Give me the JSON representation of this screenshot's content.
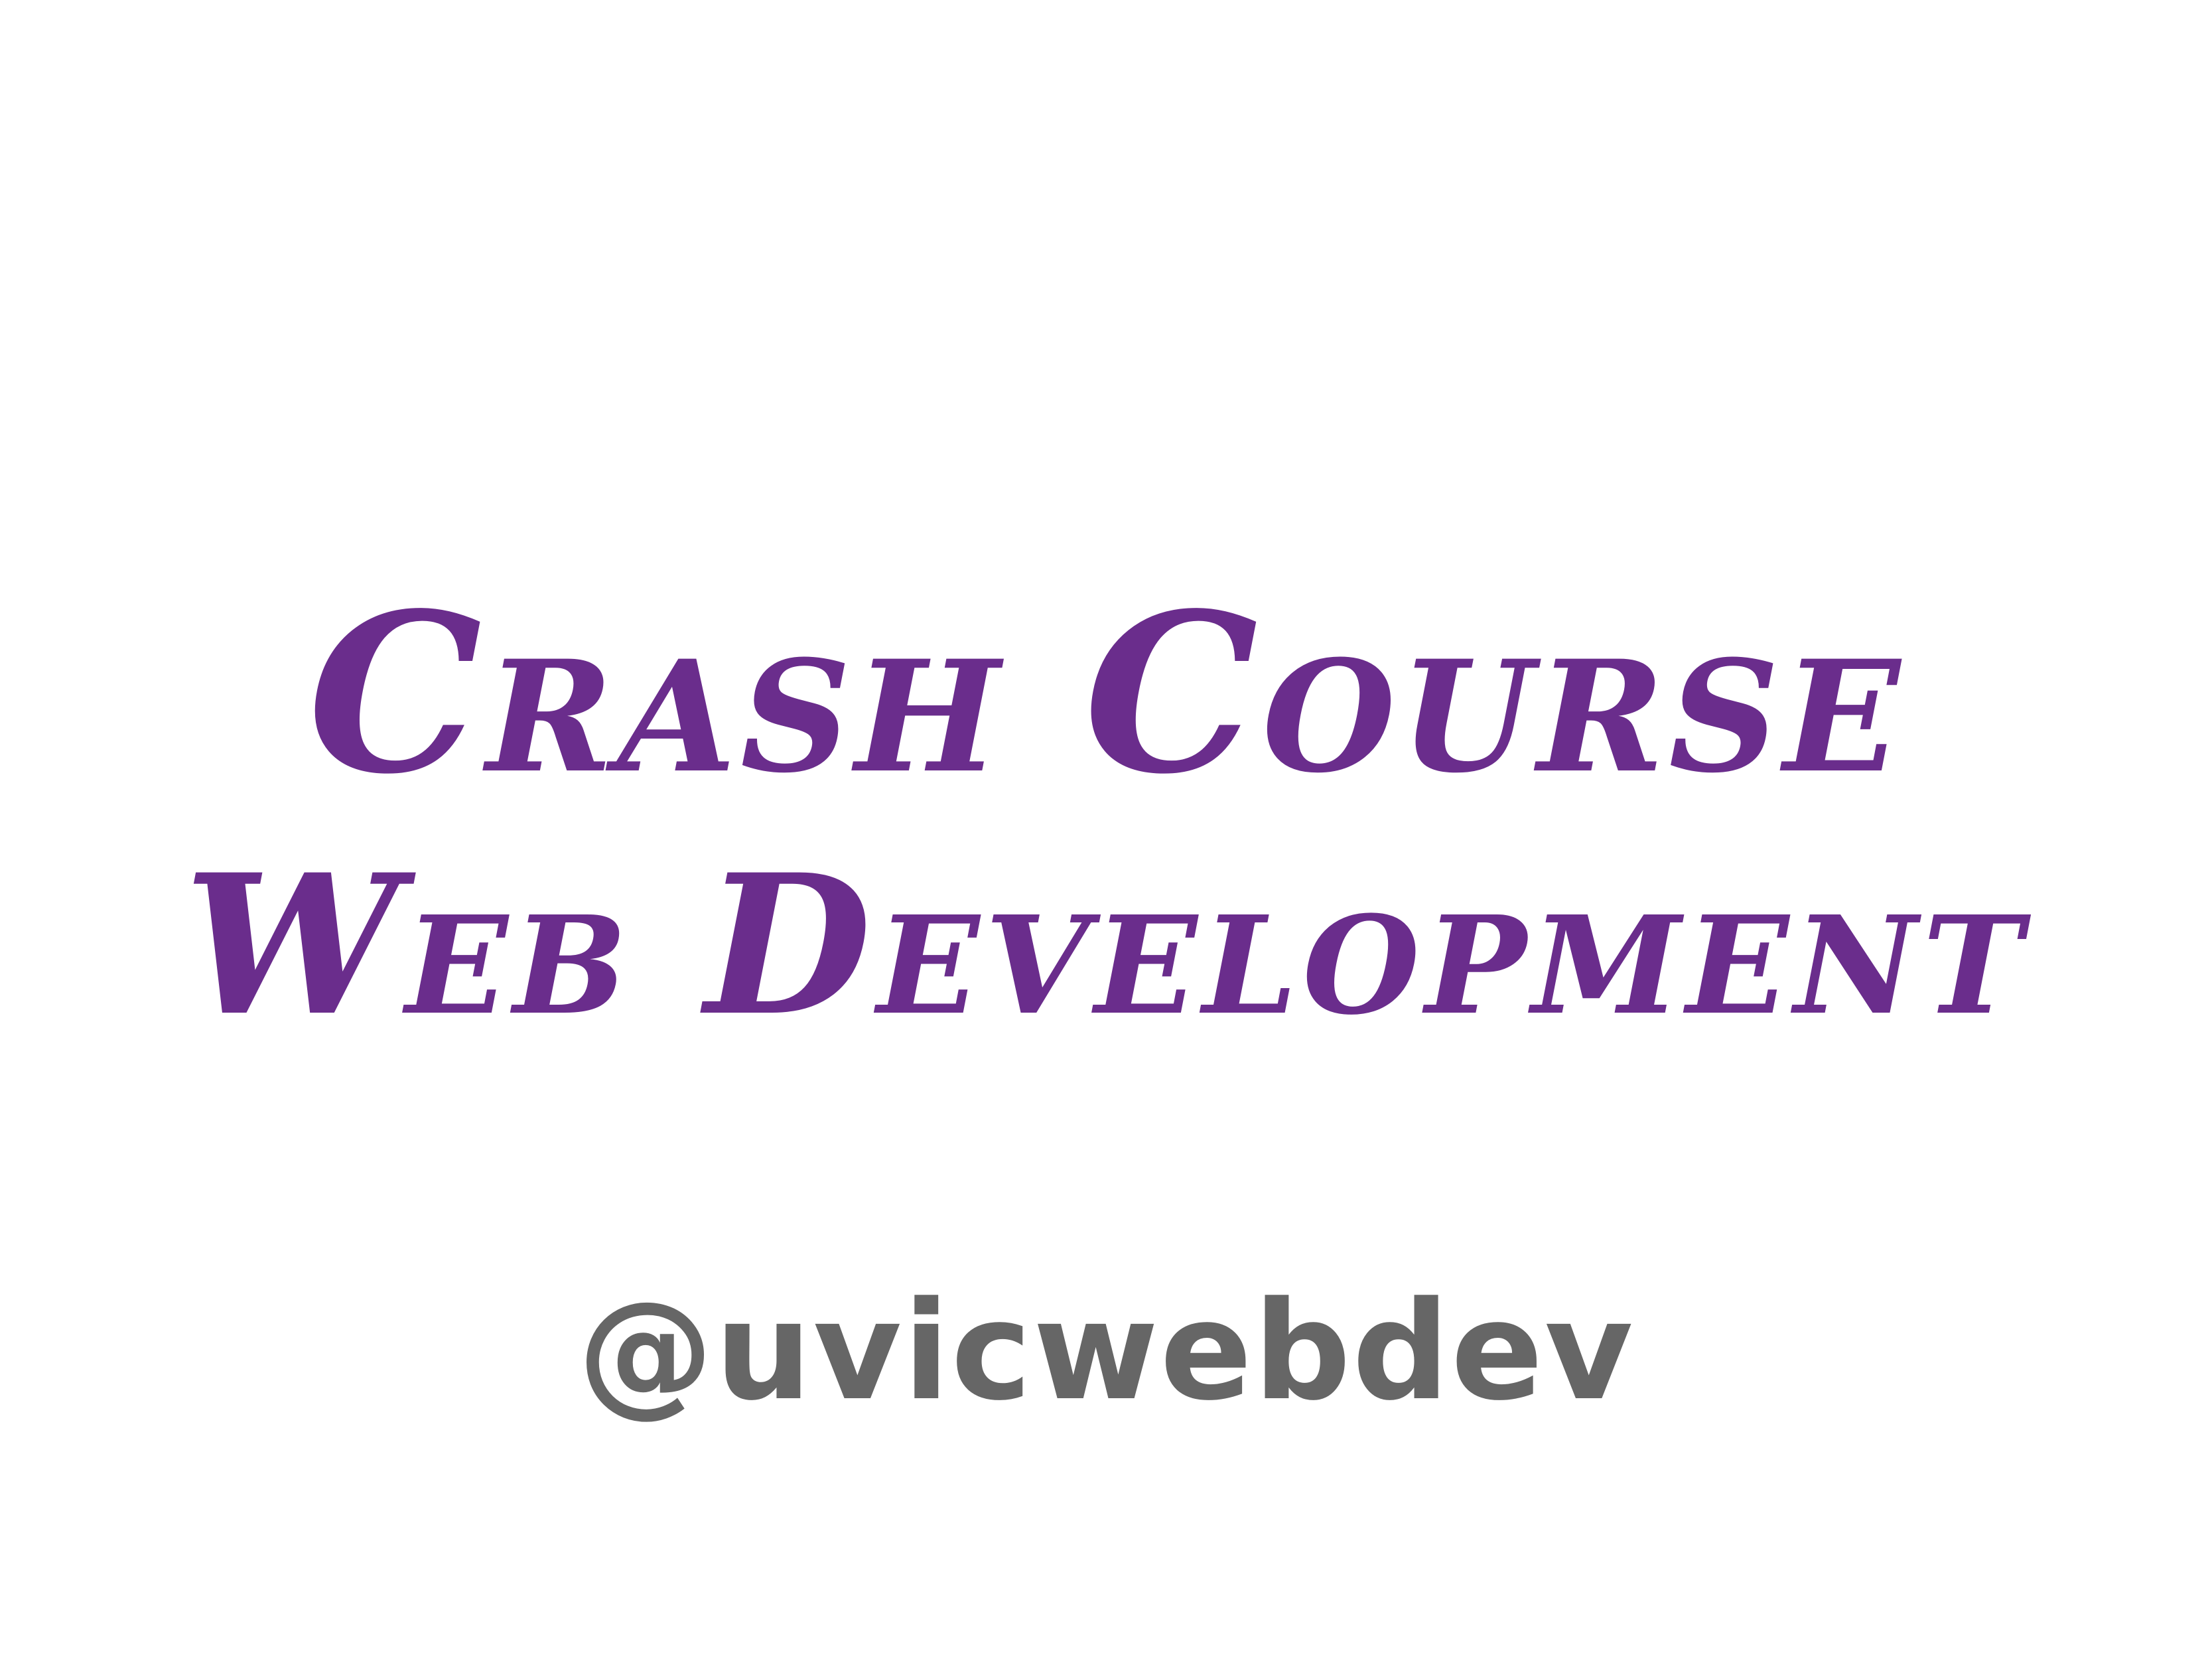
{
  "slide": {
    "title_line_1": "Crash Course",
    "title_line_2": "Web Development",
    "handle": "@uvicwebdev"
  },
  "colors": {
    "title": "#6a2d8c",
    "handle": "#666666",
    "background": "#ffffff"
  }
}
